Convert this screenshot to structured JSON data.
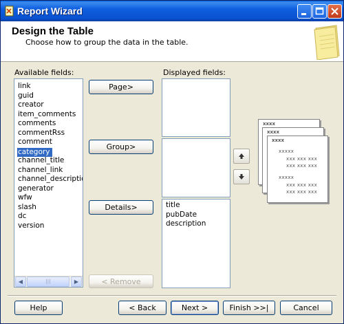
{
  "window": {
    "title": "Report Wizard"
  },
  "header": {
    "title": "Design the Table",
    "subtitle": "Choose how to group the data in the table."
  },
  "available": {
    "label": "Available fields:",
    "items": [
      "link",
      "guid",
      "creator",
      "item_comments",
      "comments",
      "commentRss",
      "comment",
      "category",
      "channel_title",
      "channel_link",
      "channel_description",
      "generator",
      "wfw",
      "slash",
      "dc",
      "version"
    ],
    "selected": "category"
  },
  "displayed": {
    "label": "Displayed fields:"
  },
  "buttons": {
    "page": "Page>",
    "group": "Group>",
    "details": "Details>",
    "remove": "< Remove"
  },
  "details_list": [
    "title",
    "pubDate",
    "description"
  ],
  "preview": {
    "header": "xxxx",
    "group_label": "xxxxx",
    "row": "xxx xxx xxx"
  },
  "footer": {
    "help": "Help",
    "back": "< Back",
    "next": "Next >",
    "finish": "Finish >>|",
    "cancel": "Cancel"
  }
}
